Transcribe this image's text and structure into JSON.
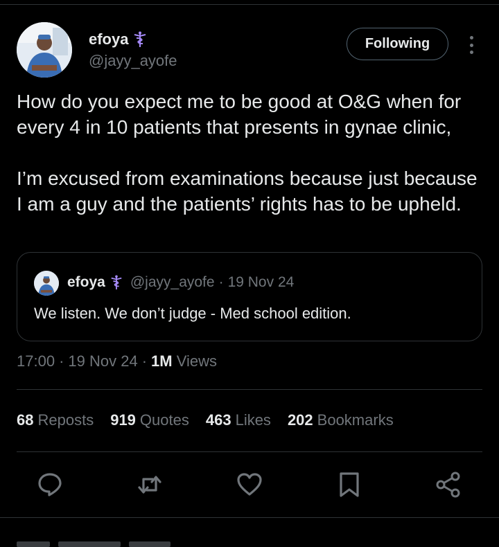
{
  "tweet": {
    "author": {
      "name": "efoya",
      "handle": "@jayy_ayofe",
      "badge_icon": "caduceus-icon",
      "badge_color": "#a78bfa"
    },
    "follow_button": "Following",
    "more_icon": "more-vertical-icon",
    "paragraphs": [
      "How do you expect me to be good at O&G when for every 4 in 10 patients that presents in gynae clinic,",
      "I’m excused from examinations because just because I am a guy and the patients’ rights has to be upheld."
    ],
    "quote": {
      "name": "efoya",
      "handle": "@jayy_ayofe",
      "separator": "·",
      "date": "19 Nov 24",
      "text": "We listen. We don’t judge - Med school edition."
    },
    "time": "17:00",
    "date": "19 Nov 24",
    "separator": "·",
    "views_count": "1M",
    "views_label": "Views",
    "stats": [
      {
        "count": "68",
        "label": "Reposts"
      },
      {
        "count": "919",
        "label": "Quotes"
      },
      {
        "count": "463",
        "label": "Likes"
      },
      {
        "count": "202",
        "label": "Bookmarks"
      }
    ],
    "actions": [
      "reply-icon",
      "repost-icon",
      "like-icon",
      "bookmark-icon",
      "share-icon"
    ]
  },
  "colors": {
    "background": "#000000",
    "primary_text": "#e7e9ea",
    "secondary_text": "#71767b",
    "border": "#2f3336"
  }
}
